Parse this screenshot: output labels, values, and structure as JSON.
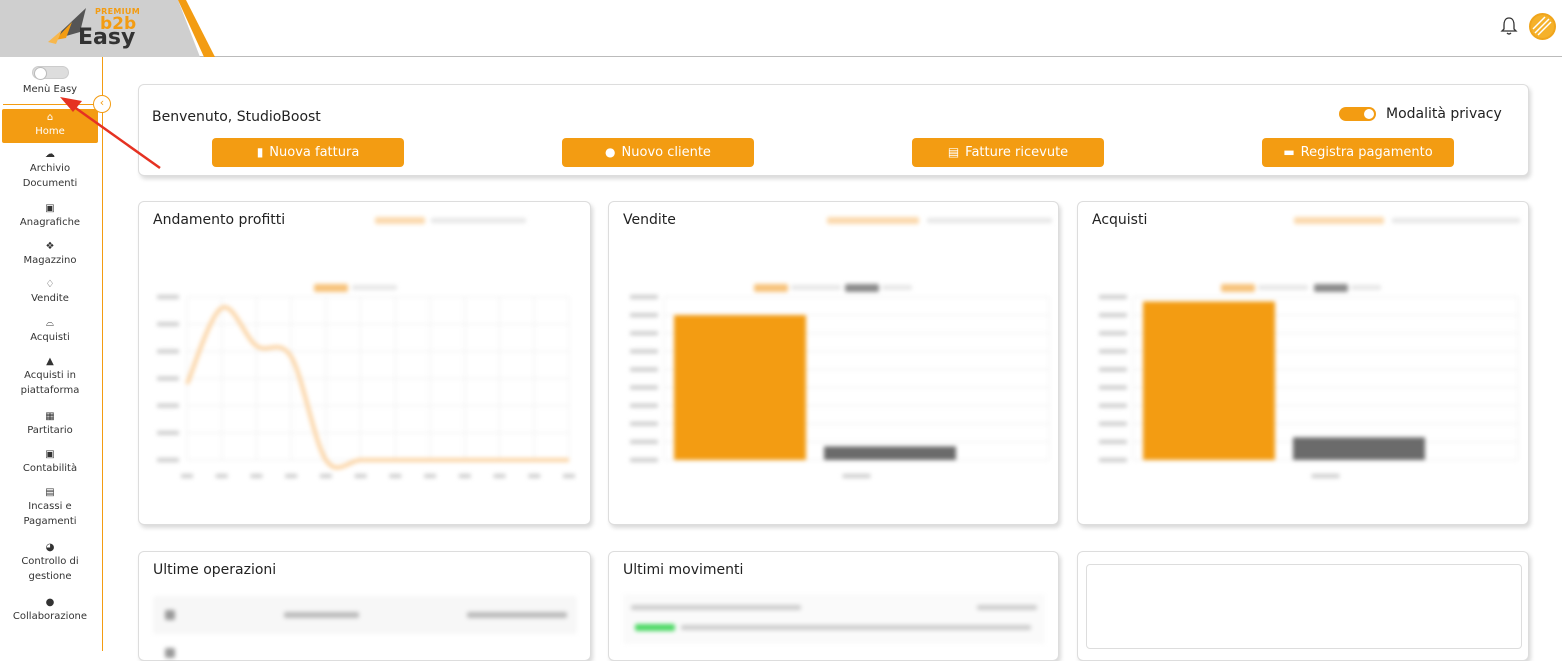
{
  "brand": {
    "premium": "PREMIUM",
    "b2b": "b2b",
    "easy": "Easy",
    "accent": "#f39c12"
  },
  "header": {
    "icons": [
      "bell-icon",
      "avatar"
    ]
  },
  "sidebar": {
    "menu_easy_label": "Menù Easy",
    "items": [
      {
        "label": "Home",
        "icon": "house-icon",
        "active": true
      },
      {
        "label": "Archivio Documenti",
        "icon": "cloud-icon"
      },
      {
        "label": "Anagrafiche",
        "icon": "contact-book-icon"
      },
      {
        "label": "Magazzino",
        "icon": "boxes-icon"
      },
      {
        "label": "Vendite",
        "icon": "handshake-icon"
      },
      {
        "label": "Acquisti",
        "icon": "basket-icon"
      },
      {
        "label": "Acquisti in piattaforma",
        "icon": "bag-icon"
      },
      {
        "label": "Partitario",
        "icon": "table-icon"
      },
      {
        "label": "Contabilità",
        "icon": "ledger-icon"
      },
      {
        "label": "Incassi e Pagamenti",
        "icon": "calendar-icon"
      },
      {
        "label": "Controllo di gestione",
        "icon": "gauge-icon"
      },
      {
        "label": "Collaborazione",
        "icon": "chat-icon"
      }
    ]
  },
  "welcome": {
    "title": "Benvenuto, StudioBoost",
    "privacy_label": "Modalità privacy",
    "buttons": [
      {
        "label": "Nuova fattura",
        "icon": "file-icon"
      },
      {
        "label": "Nuovo cliente",
        "icon": "user-icon"
      },
      {
        "label": "Fatture ricevute",
        "icon": "book-icon"
      },
      {
        "label": "Registra pagamento",
        "icon": "money-icon"
      }
    ]
  },
  "cards": {
    "profitti_title": "Andamento profitti",
    "vendite_title": "Vendite",
    "acquisti_title": "Acquisti",
    "operazioni_title": "Ultime operazioni",
    "movimenti_title": "Ultimi movimenti"
  },
  "chart_data": [
    {
      "type": "line",
      "title": "Andamento profitti",
      "x": [
        "1",
        "2",
        "3",
        "4",
        "5",
        "6",
        "7",
        "8",
        "9",
        "10",
        "11",
        "12"
      ],
      "series": [
        {
          "values": [
            14000,
            28000,
            21000,
            19000,
            0,
            0,
            0,
            0,
            0,
            0,
            0,
            0
          ],
          "color": "#fbd3a3"
        }
      ],
      "ylim": [
        0,
        30000
      ],
      "grid": true
    },
    {
      "type": "bar",
      "title": "Vendite",
      "categories": [
        ""
      ],
      "series": [
        {
          "values": [
            160000
          ],
          "color": "#f39c12"
        },
        {
          "values": [
            15000
          ],
          "color": "#6b6b6b"
        }
      ],
      "ylim": [
        0,
        180000
      ],
      "grid": true
    },
    {
      "type": "bar",
      "title": "Acquisti",
      "categories": [
        ""
      ],
      "series": [
        {
          "values": [
            175000
          ],
          "color": "#f39c12"
        },
        {
          "values": [
            25000
          ],
          "color": "#6b6b6b"
        }
      ],
      "ylim": [
        0,
        180000
      ],
      "grid": true
    }
  ]
}
